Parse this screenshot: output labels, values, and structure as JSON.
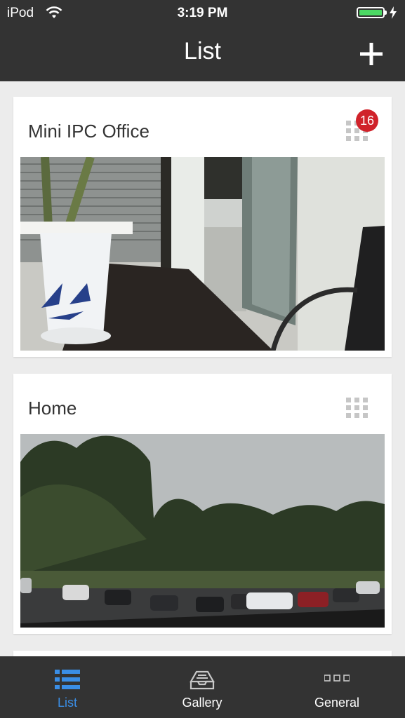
{
  "status_bar": {
    "carrier": "iPod",
    "time": "3:19 PM"
  },
  "navbar": {
    "title": "List"
  },
  "devices": [
    {
      "name": "Mini IPC Office",
      "badge": "16"
    },
    {
      "name": "Home"
    }
  ],
  "tabs": [
    {
      "label": "List",
      "icon": "list-icon",
      "active": true
    },
    {
      "label": "Gallery",
      "icon": "gallery-tray-icon",
      "active": false
    },
    {
      "label": "General",
      "icon": "more-dots-icon",
      "active": false
    }
  ],
  "colors": {
    "bar_background": "#333333",
    "accent": "#3a8ee6",
    "badge": "#d0222a",
    "battery": "#4cd964"
  }
}
